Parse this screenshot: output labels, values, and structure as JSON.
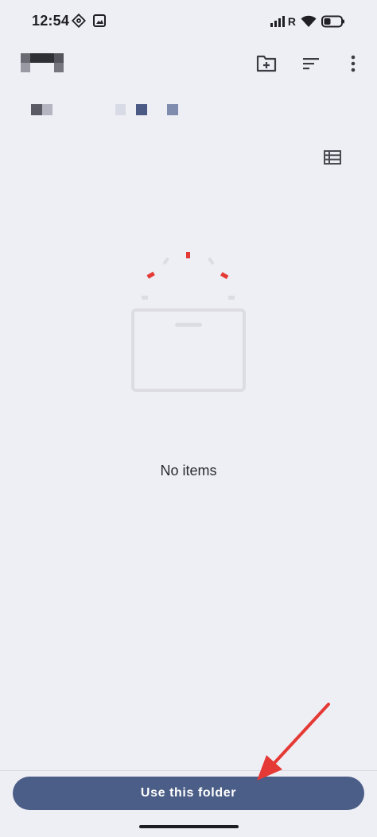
{
  "status_bar": {
    "time": "12:54",
    "icons_left": [
      "vpn-key-icon",
      "image-icon"
    ],
    "network_label": "R",
    "icons_right": [
      "signal-icon",
      "wifi-icon",
      "battery-icon"
    ]
  },
  "app_bar": {
    "logo": "redacted-logo",
    "actions": [
      "new-folder-icon",
      "sort-icon",
      "more-vert-icon"
    ]
  },
  "breadcrumb": {
    "items": [
      "redacted",
      "redacted",
      "redacted",
      "redacted"
    ],
    "colors": [
      "#5a5a64",
      "#b5b5c2",
      "#d8dae6",
      "#4b5a85",
      "#7f8cae"
    ]
  },
  "view_toggle": "list-view-icon",
  "empty_state": {
    "illustration": "empty-folder-illustration",
    "message": "No items"
  },
  "bottom": {
    "primary_button_label": "Use this folder"
  },
  "colors": {
    "background": "#eeeef5",
    "primary": "#4b5e87",
    "annotation": "#e53935"
  }
}
